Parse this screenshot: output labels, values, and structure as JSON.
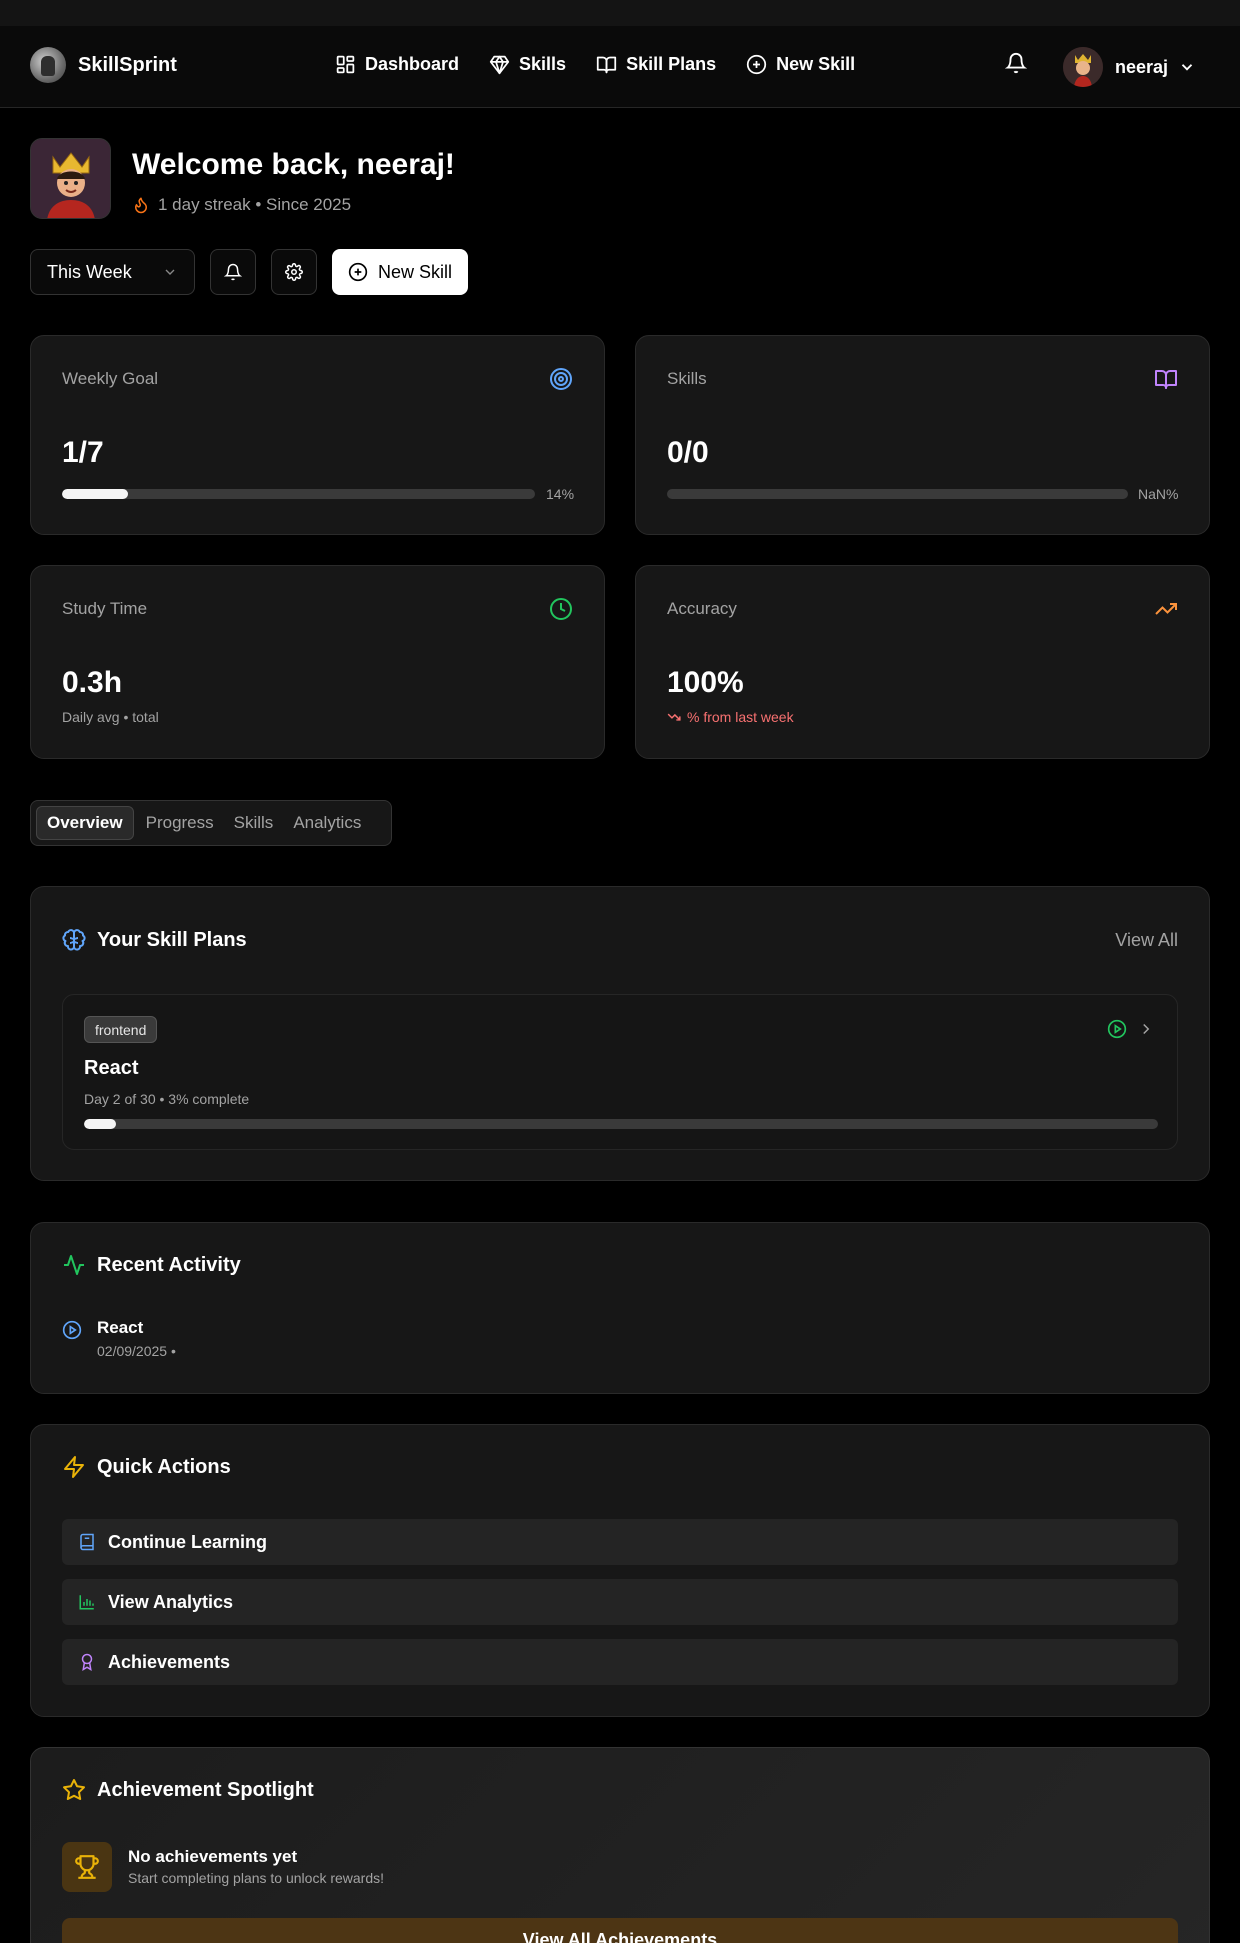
{
  "nav": {
    "brand": "SkillSprint",
    "links": [
      {
        "label": "Dashboard",
        "icon": "dashboard-icon"
      },
      {
        "label": "Skills",
        "icon": "gem-icon"
      },
      {
        "label": "Skill Plans",
        "icon": "book-open-icon"
      },
      {
        "label": "New Skill",
        "icon": "plus-circle-icon"
      }
    ],
    "user": "neeraj"
  },
  "welcome": {
    "title": "Welcome back, neeraj!",
    "subtitle": "1 day streak • Since 2025"
  },
  "controls": {
    "period": "This Week",
    "new_skill": "New Skill"
  },
  "stats": {
    "weekly_goal": {
      "label": "Weekly Goal",
      "value": "1/7",
      "percent": "14%",
      "progress": 0.14,
      "color": "#60a5fa"
    },
    "skills": {
      "label": "Skills",
      "value": "0/0",
      "percent": "NaN%",
      "progress": 0,
      "color": "#c084fc"
    },
    "study_time": {
      "label": "Study Time",
      "value": "0.3h",
      "note": "Daily avg • total",
      "color": "#22c55e"
    },
    "accuracy": {
      "label": "Accuracy",
      "value": "100%",
      "note": "% from last week",
      "color": "#fb923c"
    }
  },
  "tabs": [
    "Overview",
    "Progress",
    "Skills",
    "Analytics"
  ],
  "skill_plans": {
    "title": "Your Skill Plans",
    "view_all": "View All",
    "plan": {
      "category": "frontend",
      "name": "React",
      "meta": "Day 2 of 30 • 3% complete",
      "progress": 0.03
    }
  },
  "recent_activity": {
    "title": "Recent Activity",
    "item": {
      "name": "React",
      "date": "02/09/2025 •"
    }
  },
  "quick_actions": {
    "title": "Quick Actions",
    "items": [
      "Continue Learning",
      "View Analytics",
      "Achievements"
    ]
  },
  "achievements": {
    "title": "Achievement Spotlight",
    "empty_title": "No achievements yet",
    "empty_sub": "Start completing plans to unlock rewards!",
    "button": "View All Achievements"
  }
}
